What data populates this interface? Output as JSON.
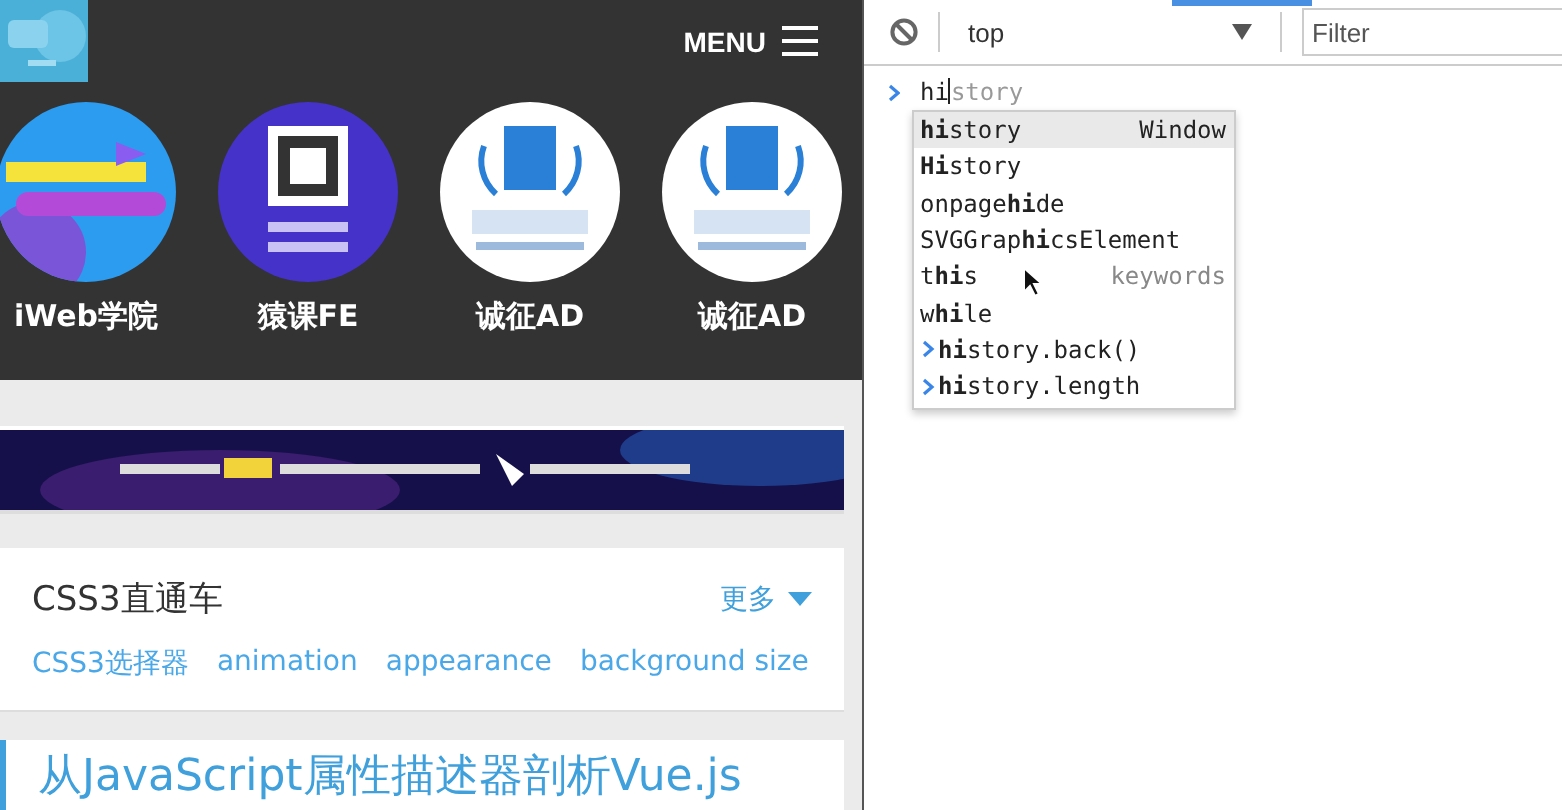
{
  "site": {
    "menu_label": "MENU",
    "shortcuts": [
      {
        "label": "iWeb学院"
      },
      {
        "label": "猿课FE"
      },
      {
        "label": "诚征AD"
      },
      {
        "label": "诚征AD"
      }
    ],
    "card": {
      "title": "CSS3直通车",
      "more": "更多",
      "tags": [
        "CSS3选择器",
        "animation",
        "appearance",
        "background size"
      ]
    },
    "article": {
      "title": "从JavaScript属性描述器剖析Vue.js"
    }
  },
  "devtools": {
    "context": "top",
    "filter": {
      "placeholder": "Filter"
    },
    "prompt": {
      "typed": "hi",
      "suggestion": "story"
    },
    "autocomplete": [
      {
        "kind": "item",
        "text": "**hi**story",
        "hint": "Window",
        "selected": true
      },
      {
        "kind": "item",
        "text": "**Hi**story",
        "selected": false
      },
      {
        "kind": "item",
        "text": "onpage**hi**de",
        "selected": false
      },
      {
        "kind": "item",
        "text": "SVGGrap**hi**csElement",
        "selected": false
      },
      {
        "kind": "item",
        "text": "t**hi**s",
        "hint": "keywords",
        "selected": false
      },
      {
        "kind": "item",
        "text": "w**hi**le",
        "selected": false
      },
      {
        "kind": "expression",
        "text": "**hi**story.back()",
        "selected": false
      },
      {
        "kind": "expression",
        "text": "**hi**story.length",
        "selected": false
      }
    ]
  }
}
